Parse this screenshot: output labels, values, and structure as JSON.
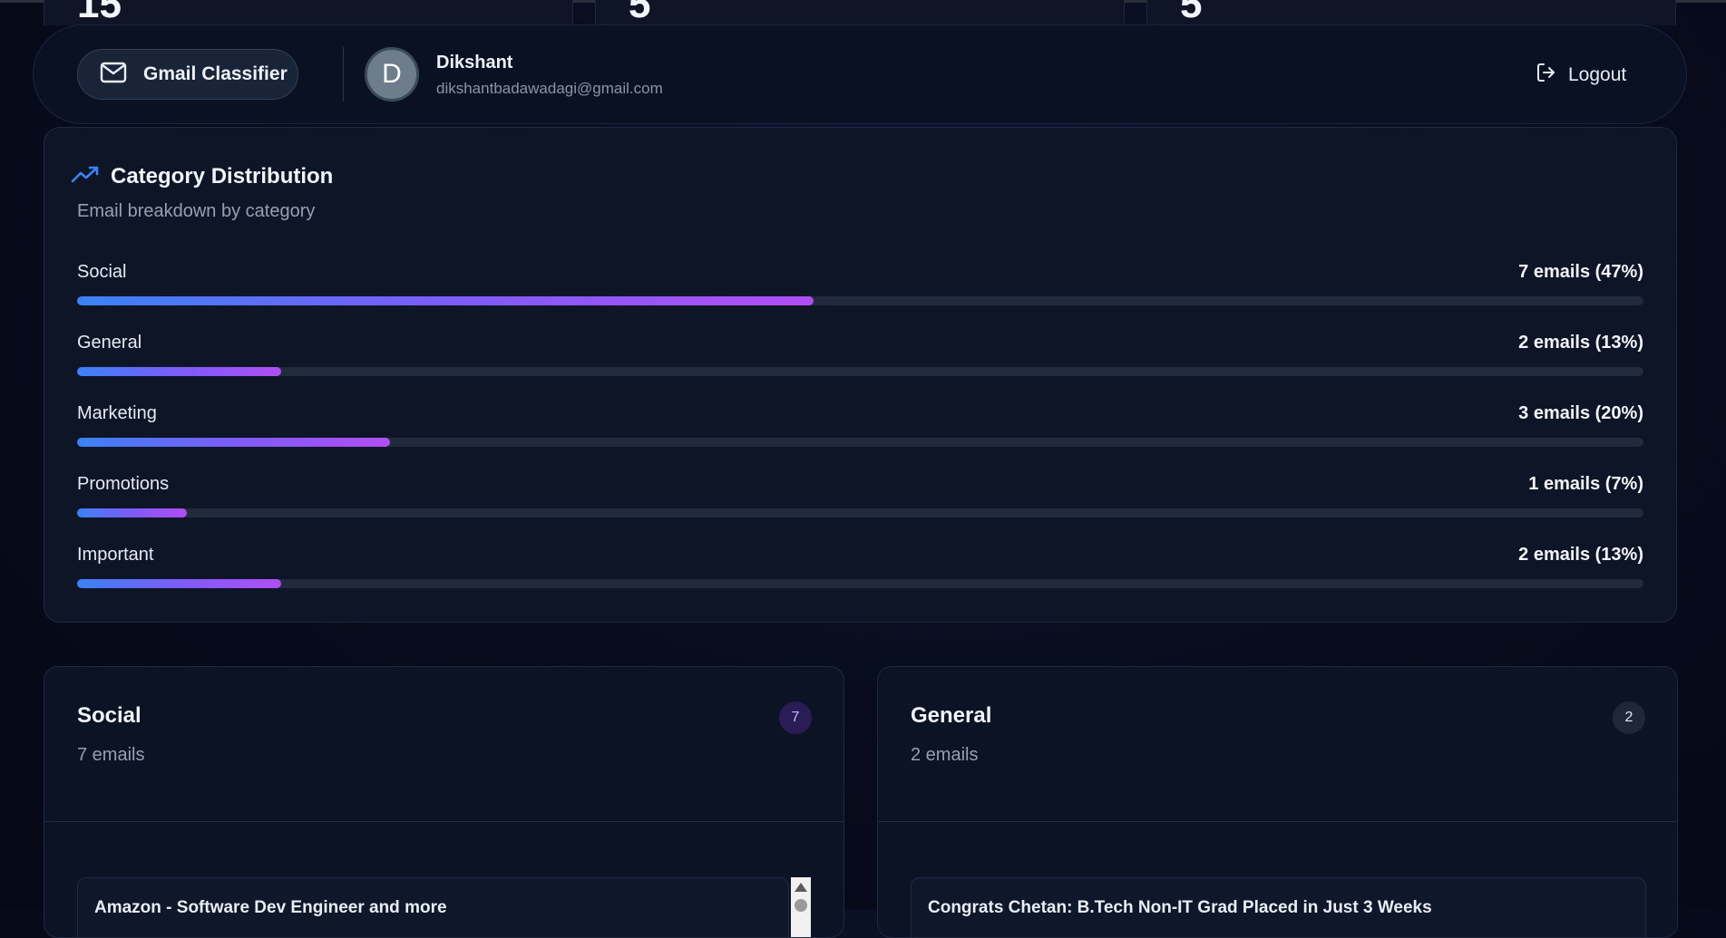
{
  "stats": {
    "values": [
      "15",
      "5",
      "5"
    ]
  },
  "header": {
    "brand_label": "Gmail Classifier",
    "user": {
      "initial": "D",
      "name": "Dikshant",
      "email": "dikshantbadawadagi@gmail.com"
    },
    "logout_label": "Logout"
  },
  "distribution": {
    "title": "Category Distribution",
    "subtitle": "Email breakdown by category",
    "rows": [
      {
        "label": "Social",
        "count_text": "7 emails (47%)",
        "percent": 47
      },
      {
        "label": "General",
        "count_text": "2 emails (13%)",
        "percent": 13
      },
      {
        "label": "Marketing",
        "count_text": "3 emails (20%)",
        "percent": 20
      },
      {
        "label": "Promotions",
        "count_text": "1 emails (7%)",
        "percent": 7
      },
      {
        "label": "Important",
        "count_text": "2 emails (13%)",
        "percent": 13
      }
    ]
  },
  "categories": [
    {
      "name": "Social",
      "count_text": "7 emails",
      "badge": "7",
      "badge_color": "#2a1d55",
      "badge_text_color": "#c7b8ff",
      "first_email": "Amazon - Software Dev Engineer and more"
    },
    {
      "name": "General",
      "count_text": "2 emails",
      "badge": "2",
      "badge_color": "#1f2738",
      "badge_text_color": "#dfe4ee",
      "first_email": "Congrats Chetan: B.Tech Non-IT Grad Placed in Just 3 Weeks"
    }
  ],
  "colors": {
    "accent_blue": "#3b82f6",
    "accent_purple": "#b14ef6",
    "trend_icon": "#3b82f6"
  },
  "icons": {
    "brand": "mail-icon",
    "logout": "logout-icon",
    "title": "trending-up-icon"
  }
}
